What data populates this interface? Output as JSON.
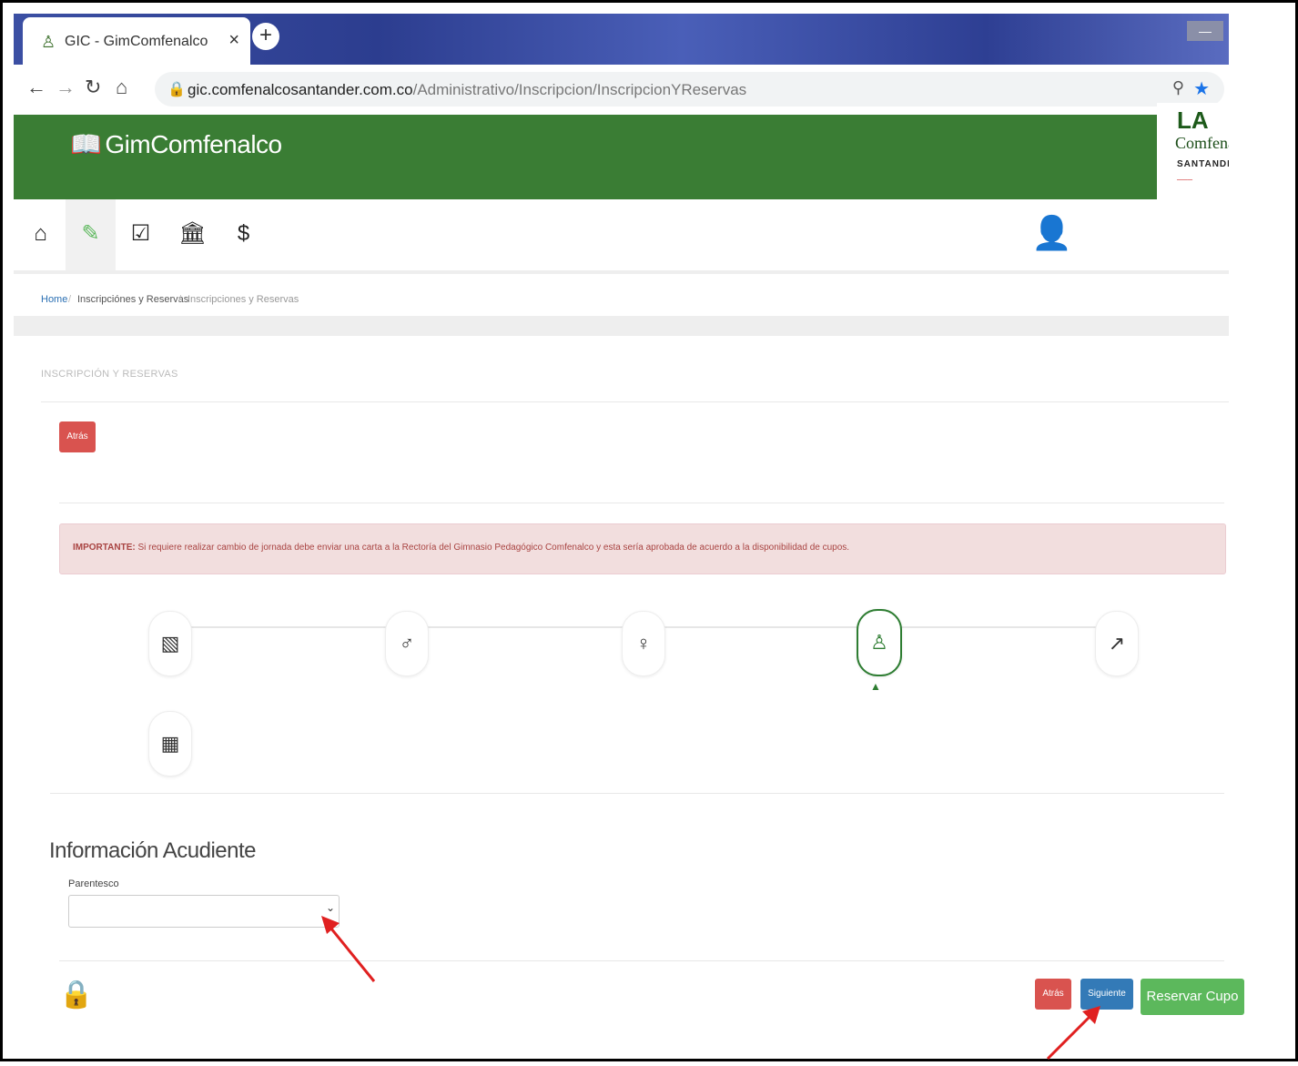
{
  "browser": {
    "tab_title": "GIC - GimComfenalco",
    "tab_close": "×",
    "new_tab": "+",
    "url_host": "gic.comfenalcosantander.com.co",
    "url_path": "/Administrativo/Inscripcion/InscripcionYReservas"
  },
  "site": {
    "brand": "GimComfenalco",
    "logo_name": "Comfenalc",
    "logo_sub": "SANTANDE"
  },
  "nav_icons": [
    "home-icon",
    "edit-icon",
    "checkbox-icon",
    "bank-icon",
    "dollar-icon"
  ],
  "breadcrumb": {
    "home": "Home",
    "sep": "/",
    "level1": "Inscripciónes y Reservas",
    "current": "Inscripciones y Reservas"
  },
  "panel": {
    "title": "INSCRIPCIÓN Y RESERVAS",
    "back_top": "Atrás"
  },
  "alert": {
    "strong": "IMPORTANTE:",
    "text": "Si requiere realizar cambio de jornada debe enviar una carta a la Rectoría del Gimnasio Pedagógico Comfenalco y esta sería aprobada de acuerdo a la disponibilidad de cupos."
  },
  "steps": {
    "active_index": 3,
    "icons": [
      "id-card-icon",
      "male-icon",
      "female-icon",
      "guardian-icon",
      "chart-icon",
      "book-icon"
    ]
  },
  "form": {
    "section_title": "Información Acudiente",
    "parentesco_label": "Parentesco",
    "parentesco_value": ""
  },
  "footer_buttons": {
    "back": "Atrás",
    "next": "Siguiente",
    "reserve": "Reservar Cupo"
  },
  "colors": {
    "header_green": "#3a7d34",
    "danger": "#d9534f",
    "primary": "#337ab7",
    "success": "#5cb85c",
    "annotation_arrow": "#e02020"
  }
}
